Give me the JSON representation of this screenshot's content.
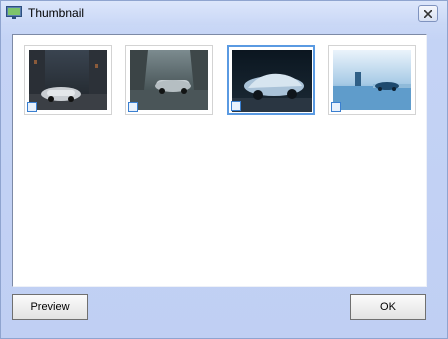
{
  "window": {
    "title": "Thumbnail",
    "icon": "thumbnail-app-icon",
    "close_icon": "close-icon"
  },
  "thumbnails": [
    {
      "name": "dark-street-car",
      "checked": true,
      "selected": false
    },
    {
      "name": "car-rainy-road",
      "checked": true,
      "selected": false
    },
    {
      "name": "silver-sports-car",
      "checked": true,
      "selected": true
    },
    {
      "name": "car-lakeside",
      "checked": true,
      "selected": false
    }
  ],
  "buttons": {
    "preview": "Preview",
    "ok": "OK"
  },
  "colors": {
    "window_bg": "#c4d3f5",
    "selection": "#5a9ae2",
    "client_bg": "#ffffff"
  }
}
